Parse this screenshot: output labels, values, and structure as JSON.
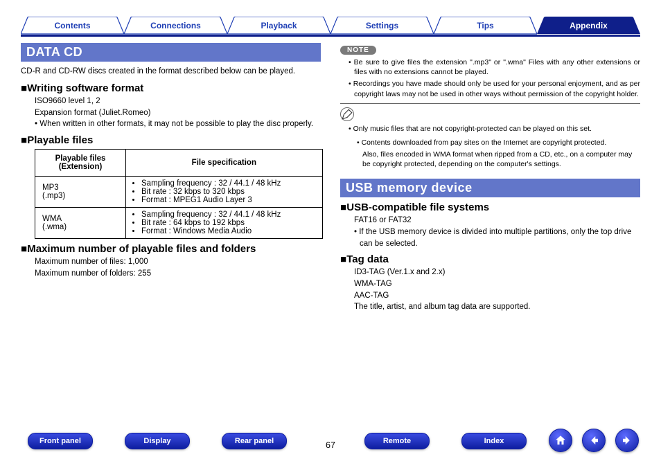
{
  "topTabs": {
    "items": [
      {
        "label": "Contents",
        "active": false
      },
      {
        "label": "Connections",
        "active": false
      },
      {
        "label": "Playback",
        "active": false
      },
      {
        "label": "Settings",
        "active": false
      },
      {
        "label": "Tips",
        "active": false
      },
      {
        "label": "Appendix",
        "active": true
      }
    ]
  },
  "left": {
    "banner": "DATA CD",
    "intro": "CD-R and CD-RW discs created in the format described below can be played.",
    "s1_title": "Writing software format",
    "s1_l1": "ISO9660 level 1, 2",
    "s1_l2": "Expansion format (Juliet.Romeo)",
    "s1_b1": "When written in other formats, it may not be possible to play the disc properly.",
    "s2_title": "Playable files",
    "table": {
      "h1": "Playable files\n(Extension)",
      "h2": "File specification",
      "rows": [
        {
          "ext": "MP3\n(.mp3)",
          "spec": [
            "Sampling frequency : 32 / 44.1 / 48 kHz",
            "Bit rate : 32 kbps to 320 kbps",
            "Format : MPEG1 Audio Layer 3"
          ]
        },
        {
          "ext": "WMA\n(.wma)",
          "spec": [
            "Sampling frequency : 32 / 44.1 / 48 kHz",
            "Bit rate : 64 kbps to 192 kbps",
            "Format : Windows Media Audio"
          ]
        }
      ]
    },
    "s3_title": "Maximum number of playable files and folders",
    "s3_l1": "Maximum number of files: 1,000",
    "s3_l2": "Maximum number of folders: 255"
  },
  "right": {
    "noteLabel": "NOTE",
    "notes": [
      "Be sure to give files the extension \".mp3\" or \".wma\" Files with any other extensions or files with no extensions cannot be played.",
      "Recordings you have made should only be used for your personal enjoyment, and as per copyright laws may not be used in other ways without permission of the copyright holder."
    ],
    "penNotes_main": "Only music files that are not copyright-protected can be played on this set.",
    "penNotes_sub1": "Contents downloaded from pay sites on the Internet are copyright protected.",
    "penNotes_sub2": "Also, files encoded in WMA format when ripped from a CD, etc., on a computer may be copyright protected, depending on the computer's settings.",
    "banner": "USB memory device",
    "s1_title": "USB-compatible file systems",
    "s1_l1": "FAT16 or FAT32",
    "s1_b1": "If the USB memory device is divided into multiple partitions, only the top drive can be selected.",
    "s2_title": "Tag data",
    "s2_l1": "ID3-TAG (Ver.1.x and 2.x)",
    "s2_l2": "WMA-TAG",
    "s2_l3": "AAC-TAG",
    "s2_l4": "The title, artist, and album tag data are supported."
  },
  "bottom": {
    "frontPanel": "Front panel",
    "display": "Display",
    "rearPanel": "Rear panel",
    "remote": "Remote",
    "index": "Index",
    "pageNumber": "67"
  }
}
